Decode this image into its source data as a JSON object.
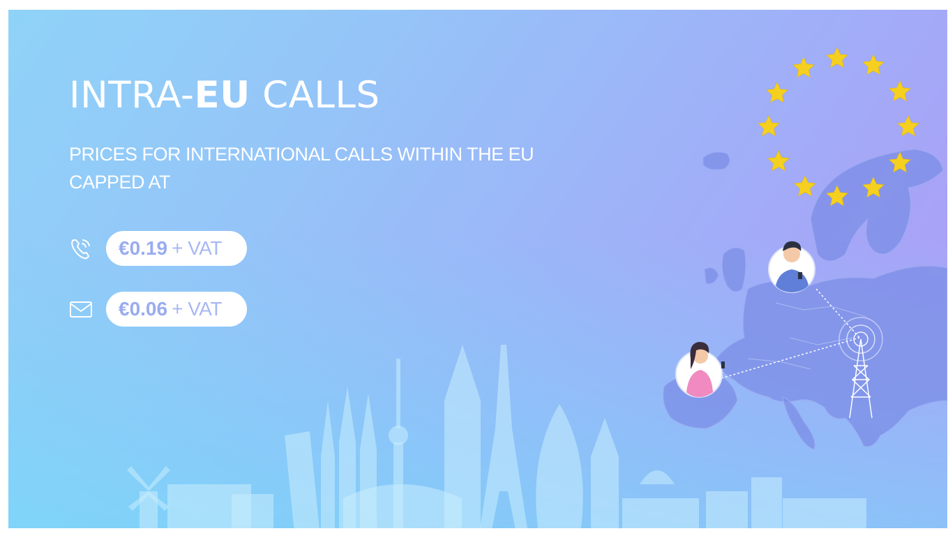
{
  "banner": {
    "title": {
      "prefix": "INTRA-",
      "bold": "EU",
      "suffix": " CALLS"
    },
    "subtitle": "PRICES FOR INTERNATIONAL CALLS WITHIN THE EU CAPPED AT",
    "prices": [
      {
        "icon": "phone-icon",
        "amount": "€0.19",
        "suffix": "+ VAT"
      },
      {
        "icon": "envelope-icon",
        "amount": "€0.06",
        "suffix": "+ VAT"
      }
    ],
    "colors": {
      "gradient_start": "#8fd3f8",
      "gradient_end": "#b19bf6",
      "star": "#f5d020",
      "pill_text": "#99acef"
    }
  }
}
